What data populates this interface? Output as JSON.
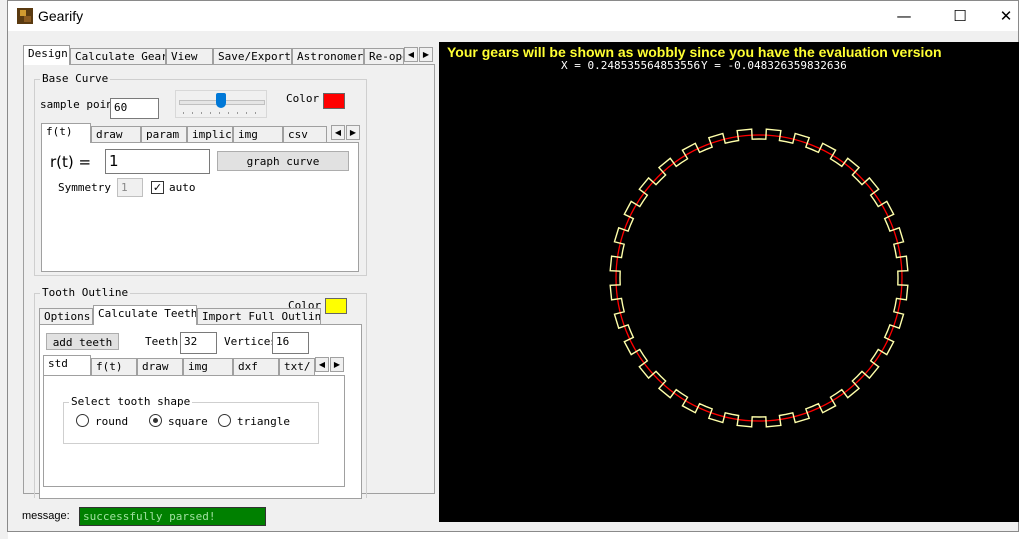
{
  "window": {
    "title": "Gearify",
    "minimize": "—",
    "maximize": "☐",
    "close": "✕"
  },
  "main_tabs": [
    "Design",
    "Calculate Gear",
    "View",
    "Save/Export",
    "Astronomer",
    "Re-ope"
  ],
  "base_curve": {
    "group_label": "Base Curve",
    "sample_points_label": "sample points",
    "sample_points_value": "60",
    "slider_value": 0.5,
    "color_label": "Color",
    "color": "#ff0000",
    "tabs": [
      "f(t)",
      "draw",
      "param",
      "implic",
      "img",
      "csv"
    ],
    "r_label": "r(t) =",
    "r_value": "1",
    "graph_button": "graph curve",
    "symmetry_label": "Symmetry",
    "symmetry_value": "1",
    "auto_label": "auto",
    "auto_checked": true
  },
  "tooth_outline": {
    "group_label": "Tooth Outline",
    "color_label": "Color",
    "color": "#ffff00",
    "tabs": [
      "Options",
      "Calculate Teeth",
      "Import Full Outline"
    ],
    "add_teeth_button": "add teeth",
    "teeth_label": "Teeth",
    "teeth_value": "32",
    "vertices_label": "Vertices",
    "vertices_value": "16",
    "sub_tabs": [
      "std",
      "f(t)",
      "draw",
      "img",
      "dxf",
      "txt/"
    ],
    "shape_group_label": "Select tooth shape",
    "shapes": [
      "round",
      "square",
      "triangle"
    ],
    "selected_shape": "square"
  },
  "canvas": {
    "banner": "Your gears will be shown as wobbly since you have the evaluation version",
    "banner_color": "#ffff33",
    "x_coord": "X = 0.248535564853556",
    "y_coord": "Y = -0.048326359832636",
    "gear_teeth": 32,
    "gear_color": "#ffffaa",
    "base_curve_color": "#ff0000"
  },
  "status": {
    "message_label": "message:",
    "message": "successfully parsed!"
  }
}
